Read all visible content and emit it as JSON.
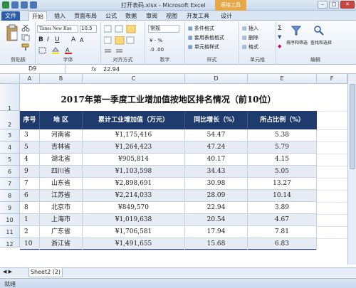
{
  "window": {
    "title": "打开表码.xlsx - Microsoft Excel",
    "context_tab": "表格工具"
  },
  "ribbon_tabs": [
    "文件",
    "开始",
    "插入",
    "页面布局",
    "公式",
    "数据",
    "审阅",
    "视图",
    "开发工具",
    "设计"
  ],
  "ribbon": {
    "font_name": "Times New Ron",
    "font_size": "10.5",
    "number_format": "常规",
    "groups": [
      "剪贴板",
      "字体",
      "对齐方式",
      "数字",
      "样式",
      "单元格",
      "编辑"
    ],
    "styles": [
      "条件格式",
      "套用表格格式",
      "单元格样式"
    ],
    "cells": [
      "插入",
      "删除",
      "格式"
    ],
    "editing": [
      "排序和筛选",
      "查找和选择"
    ]
  },
  "formula_bar": {
    "name_box": "D9",
    "fx": "fx",
    "value": "22.94"
  },
  "columns": [
    "A",
    "B",
    "C",
    "D",
    "E",
    "F"
  ],
  "rows": [
    "1",
    "2",
    "3",
    "4",
    "5",
    "6",
    "7",
    "8",
    "9",
    "10",
    "11",
    "12"
  ],
  "table": {
    "title": "2017年第一季度工业增加值按地区排名情况（前10位）",
    "headers": [
      "序号",
      "地  区",
      "累计工业增加值（万元）",
      "同比增长（%）",
      "所占比例（%）"
    ],
    "data": [
      [
        "3",
        "河南省",
        "¥1,175,416",
        "54.47",
        "5.38"
      ],
      [
        "5",
        "吉林省",
        "¥1,264,423",
        "47.24",
        "5.79"
      ],
      [
        "4",
        "湖北省",
        "¥905,814",
        "40.17",
        "4.15"
      ],
      [
        "9",
        "四川省",
        "¥1,103,598",
        "34.43",
        "5.05"
      ],
      [
        "7",
        "山东省",
        "¥2,898,691",
        "30.98",
        "13.27"
      ],
      [
        "6",
        "江苏省",
        "¥2,214,033",
        "28.09",
        "10.14"
      ],
      [
        "8",
        "北京市",
        "¥849,570",
        "22.94",
        "3.89"
      ],
      [
        "1",
        "上海市",
        "¥1,019,638",
        "20.54",
        "4.67"
      ],
      [
        "2",
        "广东省",
        "¥1,706,581",
        "17.94",
        "7.81"
      ],
      [
        "10",
        "浙江省",
        "¥1,491,655",
        "15.68",
        "6.83"
      ]
    ]
  },
  "sheet_tab": "Sheet2 (2)",
  "status": "就绪"
}
